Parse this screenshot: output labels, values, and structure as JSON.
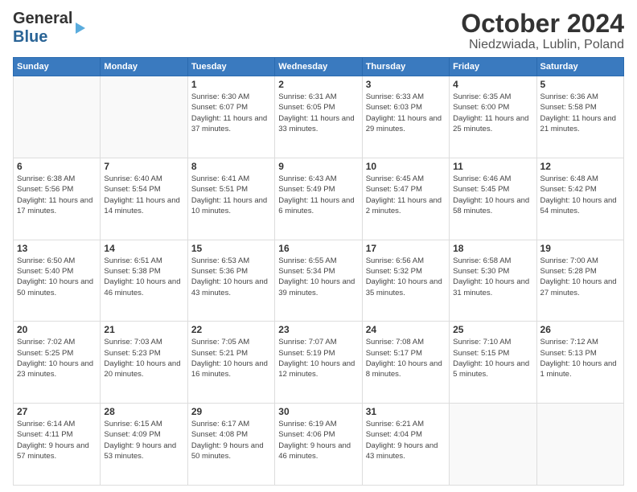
{
  "logo": {
    "line1": "General",
    "line2": "Blue"
  },
  "title": "October 2024",
  "subtitle": "Niedzwiada, Lublin, Poland",
  "headers": [
    "Sunday",
    "Monday",
    "Tuesday",
    "Wednesday",
    "Thursday",
    "Friday",
    "Saturday"
  ],
  "weeks": [
    [
      {
        "day": "",
        "detail": ""
      },
      {
        "day": "",
        "detail": ""
      },
      {
        "day": "1",
        "detail": "Sunrise: 6:30 AM\nSunset: 6:07 PM\nDaylight: 11 hours\nand 37 minutes."
      },
      {
        "day": "2",
        "detail": "Sunrise: 6:31 AM\nSunset: 6:05 PM\nDaylight: 11 hours\nand 33 minutes."
      },
      {
        "day": "3",
        "detail": "Sunrise: 6:33 AM\nSunset: 6:03 PM\nDaylight: 11 hours\nand 29 minutes."
      },
      {
        "day": "4",
        "detail": "Sunrise: 6:35 AM\nSunset: 6:00 PM\nDaylight: 11 hours\nand 25 minutes."
      },
      {
        "day": "5",
        "detail": "Sunrise: 6:36 AM\nSunset: 5:58 PM\nDaylight: 11 hours\nand 21 minutes."
      }
    ],
    [
      {
        "day": "6",
        "detail": "Sunrise: 6:38 AM\nSunset: 5:56 PM\nDaylight: 11 hours\nand 17 minutes."
      },
      {
        "day": "7",
        "detail": "Sunrise: 6:40 AM\nSunset: 5:54 PM\nDaylight: 11 hours\nand 14 minutes."
      },
      {
        "day": "8",
        "detail": "Sunrise: 6:41 AM\nSunset: 5:51 PM\nDaylight: 11 hours\nand 10 minutes."
      },
      {
        "day": "9",
        "detail": "Sunrise: 6:43 AM\nSunset: 5:49 PM\nDaylight: 11 hours\nand 6 minutes."
      },
      {
        "day": "10",
        "detail": "Sunrise: 6:45 AM\nSunset: 5:47 PM\nDaylight: 11 hours\nand 2 minutes."
      },
      {
        "day": "11",
        "detail": "Sunrise: 6:46 AM\nSunset: 5:45 PM\nDaylight: 10 hours\nand 58 minutes."
      },
      {
        "day": "12",
        "detail": "Sunrise: 6:48 AM\nSunset: 5:42 PM\nDaylight: 10 hours\nand 54 minutes."
      }
    ],
    [
      {
        "day": "13",
        "detail": "Sunrise: 6:50 AM\nSunset: 5:40 PM\nDaylight: 10 hours\nand 50 minutes."
      },
      {
        "day": "14",
        "detail": "Sunrise: 6:51 AM\nSunset: 5:38 PM\nDaylight: 10 hours\nand 46 minutes."
      },
      {
        "day": "15",
        "detail": "Sunrise: 6:53 AM\nSunset: 5:36 PM\nDaylight: 10 hours\nand 43 minutes."
      },
      {
        "day": "16",
        "detail": "Sunrise: 6:55 AM\nSunset: 5:34 PM\nDaylight: 10 hours\nand 39 minutes."
      },
      {
        "day": "17",
        "detail": "Sunrise: 6:56 AM\nSunset: 5:32 PM\nDaylight: 10 hours\nand 35 minutes."
      },
      {
        "day": "18",
        "detail": "Sunrise: 6:58 AM\nSunset: 5:30 PM\nDaylight: 10 hours\nand 31 minutes."
      },
      {
        "day": "19",
        "detail": "Sunrise: 7:00 AM\nSunset: 5:28 PM\nDaylight: 10 hours\nand 27 minutes."
      }
    ],
    [
      {
        "day": "20",
        "detail": "Sunrise: 7:02 AM\nSunset: 5:25 PM\nDaylight: 10 hours\nand 23 minutes."
      },
      {
        "day": "21",
        "detail": "Sunrise: 7:03 AM\nSunset: 5:23 PM\nDaylight: 10 hours\nand 20 minutes."
      },
      {
        "day": "22",
        "detail": "Sunrise: 7:05 AM\nSunset: 5:21 PM\nDaylight: 10 hours\nand 16 minutes."
      },
      {
        "day": "23",
        "detail": "Sunrise: 7:07 AM\nSunset: 5:19 PM\nDaylight: 10 hours\nand 12 minutes."
      },
      {
        "day": "24",
        "detail": "Sunrise: 7:08 AM\nSunset: 5:17 PM\nDaylight: 10 hours\nand 8 minutes."
      },
      {
        "day": "25",
        "detail": "Sunrise: 7:10 AM\nSunset: 5:15 PM\nDaylight: 10 hours\nand 5 minutes."
      },
      {
        "day": "26",
        "detail": "Sunrise: 7:12 AM\nSunset: 5:13 PM\nDaylight: 10 hours\nand 1 minute."
      }
    ],
    [
      {
        "day": "27",
        "detail": "Sunrise: 6:14 AM\nSunset: 4:11 PM\nDaylight: 9 hours\nand 57 minutes."
      },
      {
        "day": "28",
        "detail": "Sunrise: 6:15 AM\nSunset: 4:09 PM\nDaylight: 9 hours\nand 53 minutes."
      },
      {
        "day": "29",
        "detail": "Sunrise: 6:17 AM\nSunset: 4:08 PM\nDaylight: 9 hours\nand 50 minutes."
      },
      {
        "day": "30",
        "detail": "Sunrise: 6:19 AM\nSunset: 4:06 PM\nDaylight: 9 hours\nand 46 minutes."
      },
      {
        "day": "31",
        "detail": "Sunrise: 6:21 AM\nSunset: 4:04 PM\nDaylight: 9 hours\nand 43 minutes."
      },
      {
        "day": "",
        "detail": ""
      },
      {
        "day": "",
        "detail": ""
      }
    ]
  ]
}
